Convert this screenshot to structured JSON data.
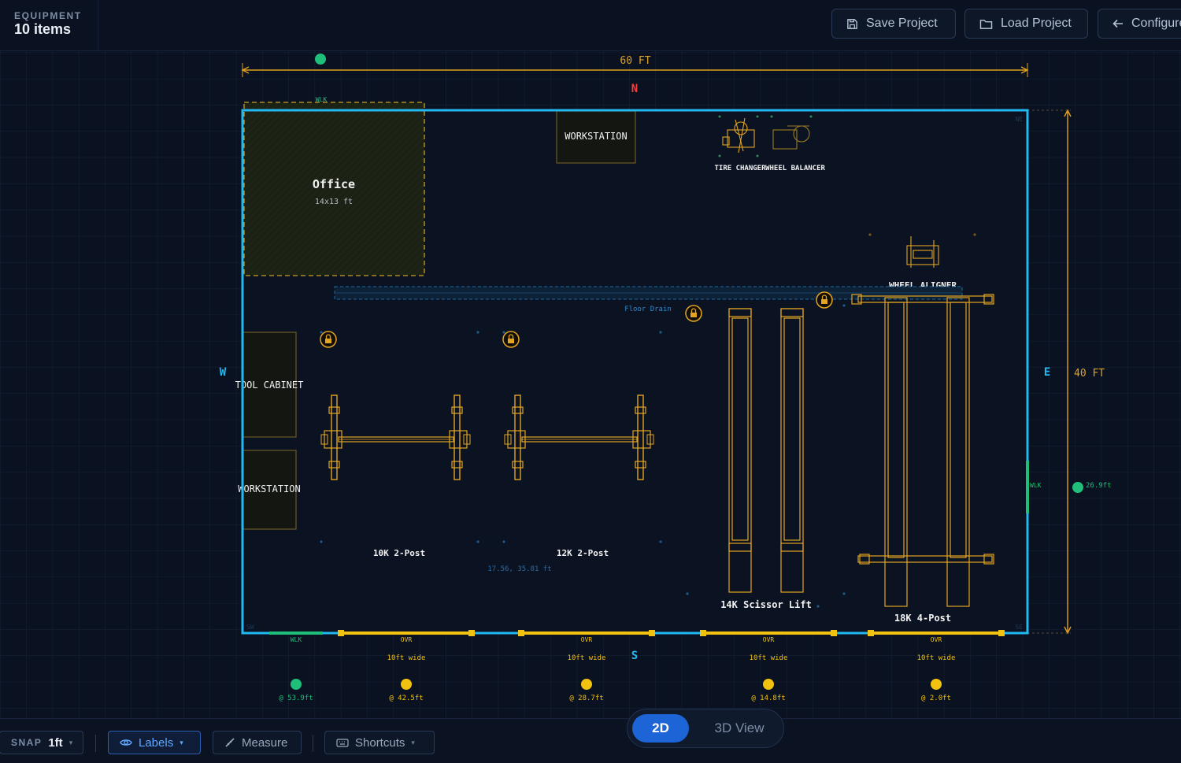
{
  "header": {
    "equipment_label": "EQUIPMENT",
    "item_count": "10 items",
    "save_label": "Save Project",
    "load_label": "Load Project",
    "config_label": "Configure"
  },
  "canvas": {
    "width_dim": "60 FT",
    "depth_dim": "40 FT",
    "compass": {
      "n": "N",
      "s": "S",
      "e": "E",
      "w": "W"
    },
    "corners": {
      "nw": "NW",
      "ne": "NE",
      "sw": "SW",
      "se": "SE"
    },
    "office": {
      "name": "Office",
      "size": "14x13 ft",
      "door": "WLK"
    },
    "workstation_top": "WORKSTATION",
    "tire_changer": "TIRE CHANGER",
    "wheel_balancer": "WHEEL BALANCER",
    "wheel_aligner": "WHEEL ALIGNER",
    "floor_drain": "Floor Drain",
    "tool_cabinet": "TOOL CABINET",
    "workstation_left": "WORKSTATION",
    "lift_10k": "10K 2-Post",
    "lift_12k": "12K 2-Post",
    "scissor": "14K Scissor Lift",
    "lift_18k": "18K 4-Post",
    "cursor_coords": "17.56, 35.81 ft",
    "east_door": {
      "label": "WLK",
      "pos": "26.9ft"
    },
    "south_doors": [
      {
        "type": "WLK",
        "width": "",
        "pos": "@ 53.9ft"
      },
      {
        "type": "OVR",
        "width": "10ft wide",
        "pos": "@ 42.5ft"
      },
      {
        "type": "OVR",
        "width": "10ft wide",
        "pos": "@ 28.7ft"
      },
      {
        "type": "OVR",
        "width": "10ft wide",
        "pos": "@ 14.8ft"
      },
      {
        "type": "OVR",
        "width": "10ft wide",
        "pos": "@ 2.0ft"
      }
    ]
  },
  "toolbar": {
    "snap_label": "SNAP",
    "snap_value": "1ft",
    "labels_label": "Labels",
    "measure_label": "Measure",
    "shortcuts_label": "Shortcuts"
  },
  "view_toggle": {
    "two_d": "2D",
    "three_d": "3D View"
  },
  "colors": {
    "wall": "#22b8f0",
    "dimension": "#e0a020",
    "equipment": "#e2a521",
    "walk_door": "#1fbf7a",
    "overhead_door": "#f2c210",
    "accent": "#1d64d6"
  }
}
